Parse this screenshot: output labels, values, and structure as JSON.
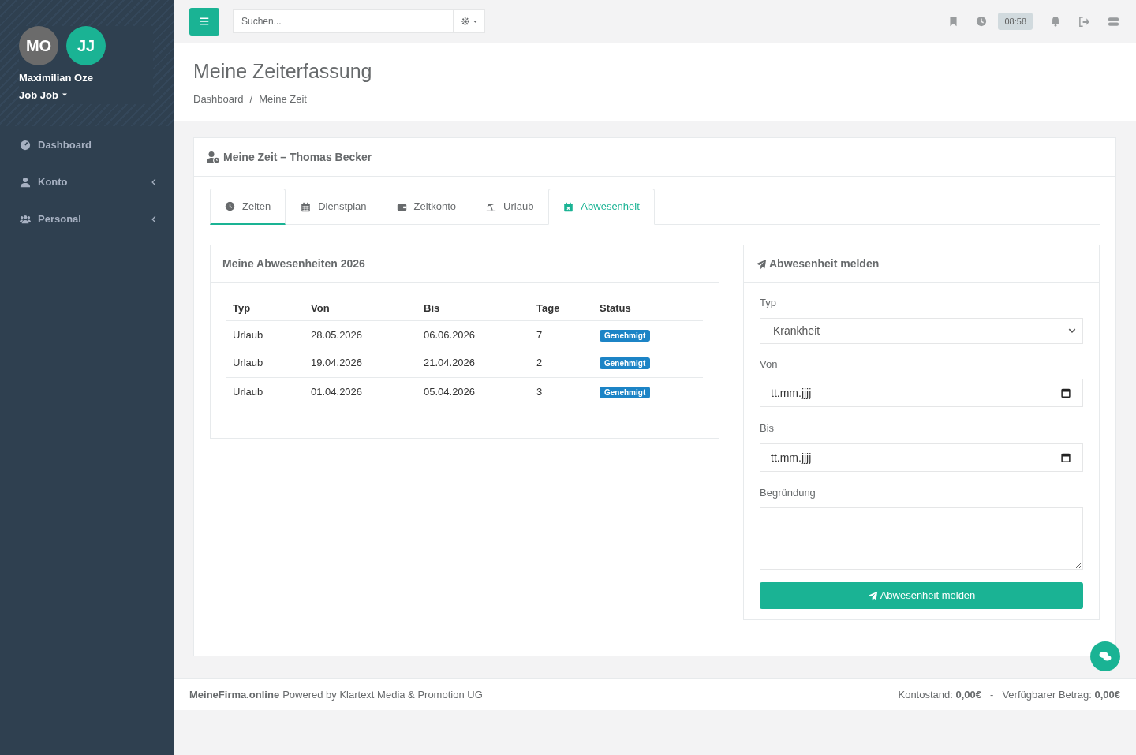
{
  "sidebar": {
    "avatars": [
      {
        "initials": "MO",
        "color": "#6b6b6b"
      },
      {
        "initials": "JJ",
        "color": "#1ab394"
      }
    ],
    "user_name": "Maximilian Oze",
    "job": "Job Job",
    "items": [
      {
        "label": "Dashboard",
        "has_submenu": false
      },
      {
        "label": "Konto",
        "has_submenu": true
      },
      {
        "label": "Personal",
        "has_submenu": true
      }
    ]
  },
  "topbar": {
    "search": {
      "placeholder": "Suchen..."
    },
    "clock": "08:58"
  },
  "page": {
    "title": "Meine Zeiterfassung",
    "breadcrumb": [
      "Dashboard",
      "Meine Zeit"
    ],
    "breadcrumb_separator": "/"
  },
  "card": {
    "title": "Meine Zeit – Thomas Becker",
    "tabs": [
      {
        "label": "Zeiten",
        "selected": false,
        "focused": true
      },
      {
        "label": "Dienstplan",
        "selected": false,
        "focused": false
      },
      {
        "label": "Zeitkonto",
        "selected": false,
        "focused": false
      },
      {
        "label": "Urlaub",
        "selected": false,
        "focused": false
      },
      {
        "label": "Abwesenheit",
        "selected": true,
        "focused": false
      }
    ]
  },
  "absences": {
    "title": "Meine Abwesenheiten 2026",
    "columns": [
      "Typ",
      "Von",
      "Bis",
      "Tage",
      "Status"
    ],
    "rows": [
      [
        "Urlaub",
        "28.05.2026",
        "06.06.2026",
        "7",
        "Genehmigt"
      ],
      [
        "Urlaub",
        "19.04.2026",
        "21.04.2026",
        "2",
        "Genehmigt"
      ],
      [
        "Urlaub",
        "01.04.2026",
        "05.04.2026",
        "3",
        "Genehmigt"
      ]
    ]
  },
  "form": {
    "title": "Abwesenheit melden",
    "fields": [
      {
        "kind": "select",
        "label": "Typ",
        "value": "Krankheit"
      },
      {
        "kind": "date",
        "label": "Von",
        "placeholder": "tt.mm.jjjj"
      },
      {
        "kind": "date",
        "label": "Bis",
        "placeholder": "tt.mm.jjjj"
      },
      {
        "kind": "textarea",
        "label": "Begründung"
      }
    ],
    "submit": "Abwesenheit melden"
  },
  "footer": {
    "brand": "MeineFirma.online",
    "credit": "Powered by Klartext Media & Promotion UG",
    "balance_label": "Kontostand:",
    "balance": "0,00€",
    "separator": "-",
    "available_label": "Verfügbarer Betrag:",
    "available": "0,00€"
  }
}
